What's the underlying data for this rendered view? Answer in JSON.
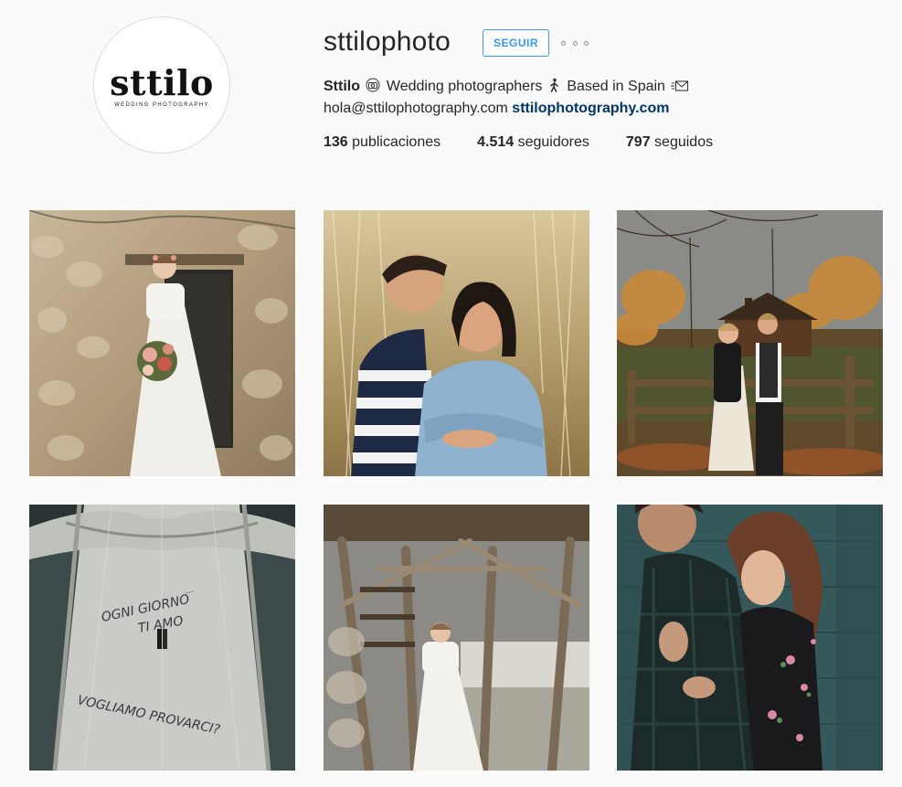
{
  "profile": {
    "avatar_logo": "sttilo",
    "avatar_sub": "WEDDING PHOTOGRAPHY",
    "username": "sttilophoto",
    "follow_label": "SEGUIR",
    "bio_name": "Sttilo",
    "bio_text_1": "Wedding photographers",
    "bio_text_2": "Based in Spain",
    "email": "hola@sttilophotography.com",
    "website": "sttilophotography.com"
  },
  "stats": {
    "posts_count": "136",
    "posts_label": "publicaciones",
    "followers_count": "4.514",
    "followers_label": "seguidores",
    "following_count": "797",
    "following_label": "seguidos"
  },
  "icons": {
    "camera": "camera-icon",
    "person_walking": "person-walking-icon",
    "envelope": "envelope-icon",
    "more": "more-options-icon"
  },
  "colors": {
    "accent": "#3897f0",
    "link": "#003569",
    "background": "#fafafa"
  },
  "posts": [
    {
      "scene": "bride in white dress holding bouquet by stone doorway"
    },
    {
      "scene": "laughing couple embracing in tall grass"
    },
    {
      "scene": "couple at wooden fence near cabin in autumn"
    },
    {
      "scene": "aerial view of couple on bridge with written words"
    },
    {
      "scene": "bride under rustic wooden staircase"
    },
    {
      "scene": "couple in dark plaid embracing against teal wall"
    }
  ],
  "post_texts": {
    "bridge_words_1": "OGNI GIORNO",
    "bridge_words_2": "TI AMO",
    "bridge_words_3": "VOGLIAMO PROVARCI?"
  }
}
